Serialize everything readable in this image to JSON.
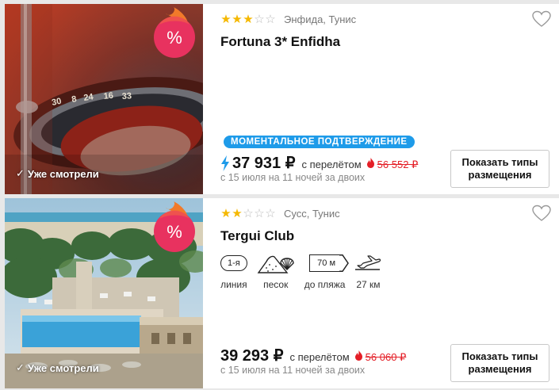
{
  "colors": {
    "accent_blue": "#1e9be9",
    "star_yellow": "#f5b800",
    "old_price_red": "#e41e26",
    "badge_pink": "#e8325f"
  },
  "hotels": [
    {
      "location": "Энфида, Тунис",
      "name": "Fortuna 3* Enfidha",
      "stars": 3,
      "max_stars": 5,
      "seen_label": "Уже смотрели",
      "badge_symbol": "%",
      "instant_label": "МОМЕНТАЛЬНОЕ ПОДТВЕРЖДЕНИЕ",
      "price": "37 931 ₽",
      "with_flight": "с перелётом",
      "old_price": "56 552 ₽",
      "dates": "с 15 июля на 11 ночей за двоих",
      "show_button_line1": "Показать типы",
      "show_button_line2": "размещения",
      "icons": [
        "favorite-heart-icon",
        "discount-badge-icon",
        "lightning-icon",
        "fire-icon",
        "check-icon"
      ]
    },
    {
      "location": "Сусс, Тунис",
      "name": "Tergui Club",
      "stars": 2,
      "max_stars": 5,
      "seen_label": "Уже смотрели",
      "badge_symbol": "%",
      "features": {
        "line_value": "1-я",
        "line_label": "линия",
        "beach_label": "песок",
        "distance_value": "70 м",
        "distance_label": "до пляжа",
        "airport_label": "27 км"
      },
      "price": "39 293 ₽",
      "with_flight": "с перелётом",
      "old_price": "56 060 ₽",
      "dates": "с 15 июля на 11 ночей за двоих",
      "show_button_line1": "Показать типы",
      "show_button_line2": "размещения",
      "icons": [
        "favorite-heart-icon",
        "discount-badge-icon",
        "sand-shell-icon",
        "airplane-icon",
        "fire-icon",
        "check-icon"
      ]
    }
  ]
}
